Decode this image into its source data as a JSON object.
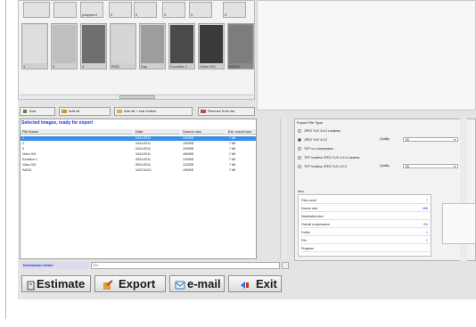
{
  "thumb_top_labels": [
    "",
    "",
    "pospperd",
    "0",
    "0",
    "0",
    "0",
    "0"
  ],
  "thumbnails": [
    {
      "caption": "1",
      "tone": "#dedede",
      "selected": false
    },
    {
      "caption": "2",
      "tone": "#bfbfbf",
      "selected": false
    },
    {
      "caption": "3",
      "tone": "#6f6f6f",
      "selected": false
    },
    {
      "caption": "RGD",
      "tone": "#d6d6d6",
      "selected": false
    },
    {
      "caption": "Day",
      "tone": "#9d9d9d",
      "selected": false
    },
    {
      "caption": "Excellive 1",
      "tone": "#4a4a4a",
      "selected": false
    },
    {
      "caption": "Video 001",
      "tone": "#3a3a3a",
      "selected": false
    },
    {
      "caption": "IMG01",
      "tone": "#7d7d7d",
      "selected": true
    }
  ],
  "toolbar": {
    "add": "Add",
    "add_all": "Add all",
    "add_all_subfolders": "Add all + sub folders",
    "remove_from_list": "Remove from list"
  },
  "list": {
    "title": "Selected images, ready for export",
    "columns": [
      "File Name",
      "Date",
      "Source size",
      "Est. result size"
    ],
    "rows": [
      [
        "1",
        "04/11/2011",
        "1200KB",
        "7 kB"
      ],
      [
        "2",
        "04/11/2011",
        "1500KB",
        "7 kB"
      ],
      [
        "3",
        "04/11/2011",
        "1900KB",
        "7 kB"
      ],
      [
        "Video 001",
        "04/11/2011",
        "4960KB",
        "7 kB"
      ],
      [
        "Excellive 1",
        "05/11/2011",
        "1200KB",
        "7 kB"
      ],
      [
        "Video 001",
        "05/11/2011",
        "1322KB",
        "7 kB"
      ],
      [
        "IMG01",
        "04/27/2010",
        "1960KB",
        "7 kB"
      ]
    ],
    "selected_row": 0
  },
  "destination": {
    "label": "Destination folder",
    "value": "C:\\"
  },
  "buttons": {
    "estimate": "Estimate",
    "export": "Export",
    "email": "e-mail",
    "exit": "Exit"
  },
  "export_panel": {
    "title": "Export File Type",
    "options": [
      {
        "label": "JPEG YUV 4:4:4 Lossless",
        "selected": false
      },
      {
        "label": "JPEG YUV 4:2:2",
        "selected": true
      },
      {
        "label": "TIFF no compression",
        "selected": false
      },
      {
        "label": "TIFF lossless JPEG YUV 4:4:4 Lossless",
        "selected": false
      },
      {
        "label": "TIFF lossless JPEG YUV 4:2:2",
        "selected": false
      }
    ],
    "quality_label": "Quality",
    "quality_value": "90"
  },
  "info": {
    "title": "Info",
    "rows": [
      {
        "label": "Files count",
        "value": "7"
      },
      {
        "label": "Source size",
        "value": "0kB"
      },
      {
        "label": "Destination size",
        "value": ""
      },
      {
        "label": "Overall compression",
        "value": "0%"
      },
      {
        "label": "Folder",
        "value": "1"
      },
      {
        "label": "File",
        "value": "1"
      },
      {
        "label": "Progress",
        "value": ""
      }
    ]
  },
  "colors": {
    "accent_blue": "#1a3bd6",
    "selection": "#3a8ee6"
  }
}
